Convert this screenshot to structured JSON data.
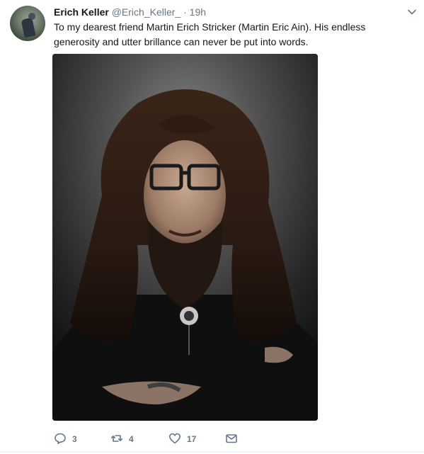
{
  "tweet": {
    "author_name": "Erich Keller",
    "author_handle": "@Erich_Keller_",
    "separator": "·",
    "time": "19h",
    "text": "To my dearest friend Martin Erich Stricker (Martin Eric Ain). His endless generosity and utter brillance can never be put into words."
  },
  "actions": {
    "reply_count": "3",
    "retweet_count": "4",
    "like_count": "17"
  },
  "icons": {
    "caret": "chevron-down-icon",
    "reply": "reply-icon",
    "retweet": "retweet-icon",
    "like": "heart-icon",
    "dm": "envelope-icon"
  },
  "colors": {
    "text": "#14171a",
    "secondary": "#657786",
    "border": "#e6ecf0"
  }
}
